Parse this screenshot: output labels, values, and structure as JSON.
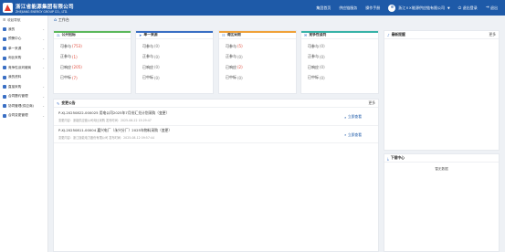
{
  "header": {
    "company_cn": "浙江省能源集团有限公司",
    "company_en": "ZHEJIANG ENERGY GROUP CO., LTD.",
    "nav": [
      "集团首页",
      "供应链服务",
      "操作手册"
    ],
    "user_name": "浙江××能源供应链有限公司",
    "logout_label": "退出登录",
    "exit_label": "退出"
  },
  "sidebar": {
    "toggle_label": "收起导航",
    "items": [
      {
        "label": "我的"
      },
      {
        "label": "预警中心"
      },
      {
        "label": "单一来源"
      },
      {
        "label": "询比采购"
      },
      {
        "label": "竞争性谈判磋商"
      },
      {
        "label": "我的资料"
      },
      {
        "label": "直接采购"
      },
      {
        "label": "合同履约管理"
      },
      {
        "label": "协同管理(供应商)"
      },
      {
        "label": "合同变更管理"
      }
    ]
  },
  "breadcrumb": {
    "label": "工作台"
  },
  "panels": {
    "bidding": {
      "title": "公开招标",
      "rows": [
        {
          "label": "可参与",
          "count": "(753)"
        },
        {
          "label": "正参与",
          "count": "(1)"
        },
        {
          "label": "已响应",
          "count": "(205)"
        },
        {
          "label": "已中标",
          "count": "(7)"
        }
      ]
    },
    "single": {
      "title": "单一来源",
      "rows": [
        {
          "label": "可参与",
          "count": "(0)"
        },
        {
          "label": "正参与",
          "count": "(0)"
        },
        {
          "label": "已响应",
          "count": "(0)"
        },
        {
          "label": "已中标",
          "count": "(0)"
        }
      ]
    },
    "compare": {
      "title": "询比采购",
      "rows": [
        {
          "label": "可参与",
          "count": "(5)"
        },
        {
          "label": "正参与",
          "count": "(0)"
        },
        {
          "label": "已响应",
          "count": "(2)"
        },
        {
          "label": "已中标",
          "count": "(0)"
        }
      ]
    },
    "compete": {
      "title": "竞争性谈判",
      "rows": [
        {
          "label": "可参与",
          "count": "(0)"
        },
        {
          "label": "正参与",
          "count": "(0)"
        },
        {
          "label": "已响应",
          "count": "(0)"
        },
        {
          "label": "已中标",
          "count": "(0)"
        }
      ]
    },
    "notices": {
      "title": "变更公告",
      "more": "更多",
      "items": [
        {
          "title": "P-XJ-20250822-000025  用电公司2025年7月份汇兑计划采购（变更）",
          "meta": "变更内容：浙能供应链公司询比采购   发布时间：2025-08-22 15:29:47",
          "button": "立即查看"
        },
        {
          "title": "P-XJ-20250811-00004  嘉兴电厂（永兴分厂）2025年物料采购（变更）",
          "meta": "变更内容：浙江浙能电力股份有限公司   发布时间：2025-08-12 09:57:44",
          "button": "立即查看"
        }
      ]
    },
    "latest": {
      "title": "最新提醒",
      "more": "更多"
    },
    "download": {
      "title": "下载中心",
      "empty": "暂无数据"
    }
  },
  "colors": {
    "brand": "#1e5aa8",
    "accent_red": "#e04a3a",
    "bar_green": "#5cb85c",
    "bar_blue": "#3a6fc4",
    "bar_orange": "#f0a23a",
    "bar_teal": "#39b3a8"
  }
}
